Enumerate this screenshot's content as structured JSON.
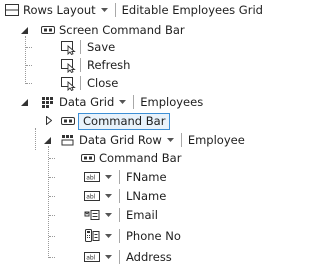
{
  "tree": {
    "root": {
      "label": "Rows Layout",
      "value": "Editable Employees Grid",
      "icon": "rows-layout-icon"
    },
    "screen_command_bar": {
      "label": "Screen Command Bar",
      "icon": "command-bar-icon",
      "commands": [
        {
          "label": "Save",
          "icon": "command-icon"
        },
        {
          "label": "Refresh",
          "icon": "command-icon"
        },
        {
          "label": "Close",
          "icon": "command-icon"
        }
      ]
    },
    "data_grid": {
      "label": "Data Grid",
      "value": "Employees",
      "icon": "data-grid-icon",
      "command_bar": {
        "label": "Command Bar",
        "icon": "command-bar-icon",
        "selected": true
      },
      "row": {
        "label": "Data Grid Row",
        "value": "Employee",
        "icon": "data-grid-row-icon",
        "command_bar": {
          "label": "Command Bar",
          "icon": "command-bar-icon"
        },
        "fields": [
          {
            "label": "FName",
            "icon": "textbox-icon"
          },
          {
            "label": "LName",
            "icon": "textbox-icon"
          },
          {
            "label": "Email",
            "icon": "email-address-editor-icon"
          },
          {
            "label": "Phone No",
            "icon": "phone-number-editor-icon"
          },
          {
            "label": "Address",
            "icon": "textbox-icon"
          }
        ]
      }
    }
  },
  "colors": {
    "text": "#1e1e1e",
    "selection_border": "#3d8fd6",
    "selection_fill": "#e8f2fb",
    "separator": "#a8a8a8",
    "tree_line": "#9a9a9a",
    "icon": "#333333"
  }
}
